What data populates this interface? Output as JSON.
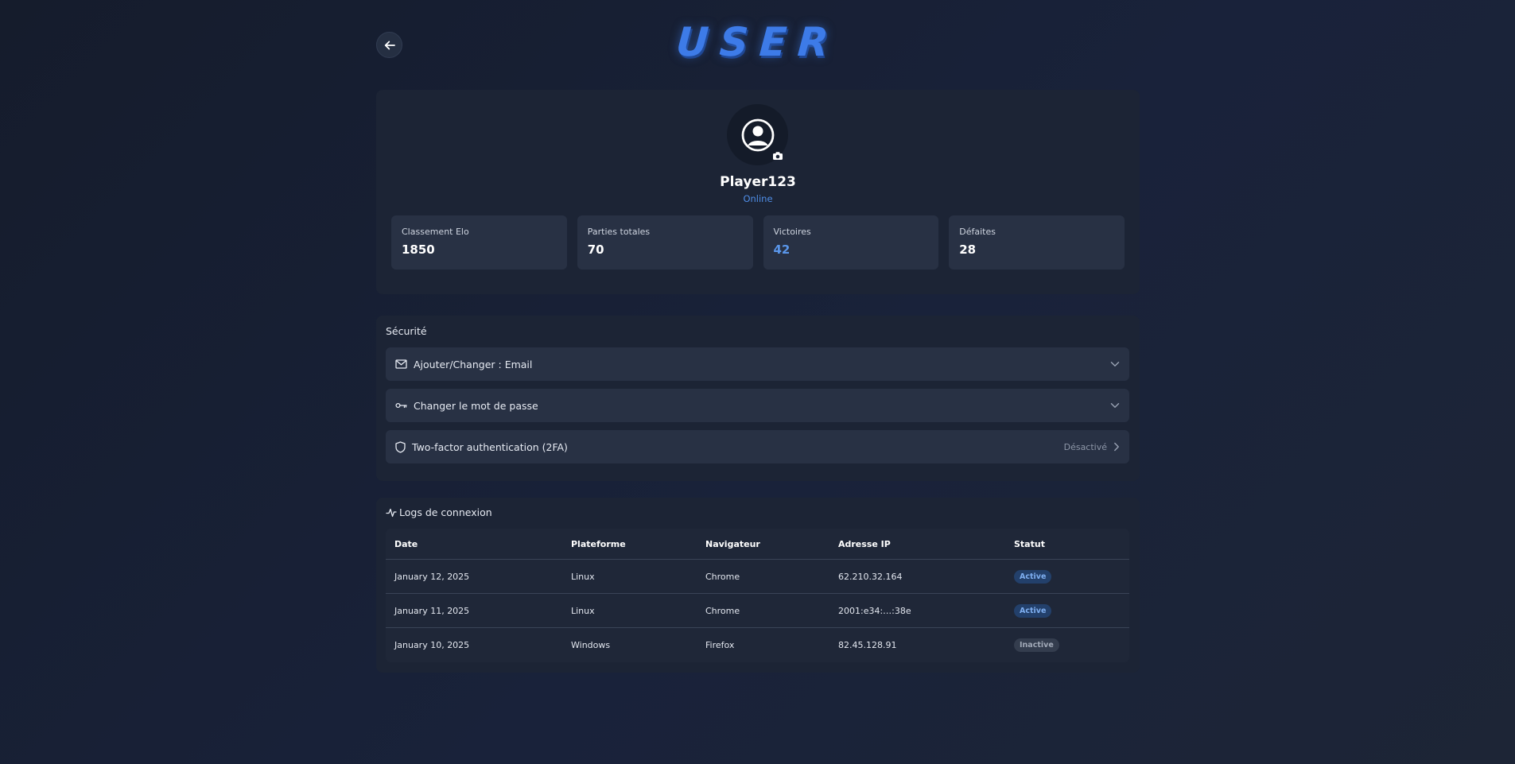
{
  "header": {
    "title": "USER",
    "back_icon": "arrow-left-icon"
  },
  "profile": {
    "avatar_icon": "user-circle-icon",
    "camera_icon": "camera-icon",
    "username": "Player123",
    "status": "Online",
    "stats": [
      {
        "label": "Classement Elo",
        "value": "1850"
      },
      {
        "label": "Parties totales",
        "value": "70"
      },
      {
        "label": "Victoires",
        "value": "42"
      },
      {
        "label": "Défaites",
        "value": "28"
      }
    ]
  },
  "security": {
    "title": "Sécurité",
    "items": [
      {
        "icon": "mail-icon",
        "label": "Ajouter/Changer : Email",
        "action_icon": "chevron-down-icon"
      },
      {
        "icon": "key-icon",
        "label": "Changer le mot de passe",
        "action_icon": "chevron-down-icon"
      },
      {
        "icon": "shield-icon",
        "label": "Two-factor authentication (2FA)",
        "status": "Désactivé",
        "action_icon": "chevron-right-icon"
      }
    ]
  },
  "logs": {
    "title": "Logs de connexion",
    "icon": "activity-icon",
    "columns": [
      "Date",
      "Plateforme",
      "Navigateur",
      "Adresse IP",
      "Statut"
    ],
    "rows": [
      {
        "date": "January 12, 2025",
        "platform": "Linux",
        "browser": "Chrome",
        "ip": "62.210.32.164",
        "status": "Active"
      },
      {
        "date": "January 11, 2025",
        "platform": "Linux",
        "browser": "Chrome",
        "ip": "2001:e34:…:38e",
        "status": "Active"
      },
      {
        "date": "January 10, 2025",
        "platform": "Windows",
        "browser": "Firefox",
        "ip": "82.45.128.91",
        "status": "Inactive"
      }
    ]
  },
  "colors": {
    "accent": "#3d7be8",
    "background": "#151c2c",
    "card": "#1c2435",
    "badge_active": "#23406b",
    "badge_inactive": "#343d4e"
  }
}
